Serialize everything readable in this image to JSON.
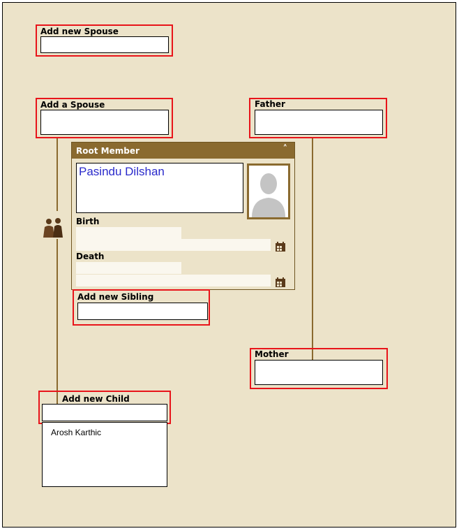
{
  "add_new_spouse": {
    "label": "Add new Spouse",
    "value": ""
  },
  "add_a_spouse": {
    "label": "Add a Spouse",
    "value": ""
  },
  "father": {
    "label": "Father",
    "value": ""
  },
  "mother": {
    "label": "Mother",
    "value": ""
  },
  "root_member": {
    "title": "Root Member",
    "collapse_icon": "chevron-up-icon",
    "name": "Pasindu Dilshan",
    "photo_icon": "person-silhouette-icon",
    "birth": {
      "label": "Birth",
      "date": "",
      "place": "",
      "icon": "calendar-icon"
    },
    "death": {
      "label": "Death",
      "date": "",
      "place": "",
      "icon": "calendar-icon"
    }
  },
  "add_new_sibling": {
    "label": "Add new Sibling",
    "value": ""
  },
  "add_new_child": {
    "label": "Add new Child",
    "value": ""
  },
  "children": [
    "Arosh Karthic"
  ],
  "couple_icon": "couple-icon",
  "colors": {
    "background": "#ece3c9",
    "accent": "#8a6a2f",
    "highlight": "#e8141a",
    "name_text": "#2a2acb"
  }
}
